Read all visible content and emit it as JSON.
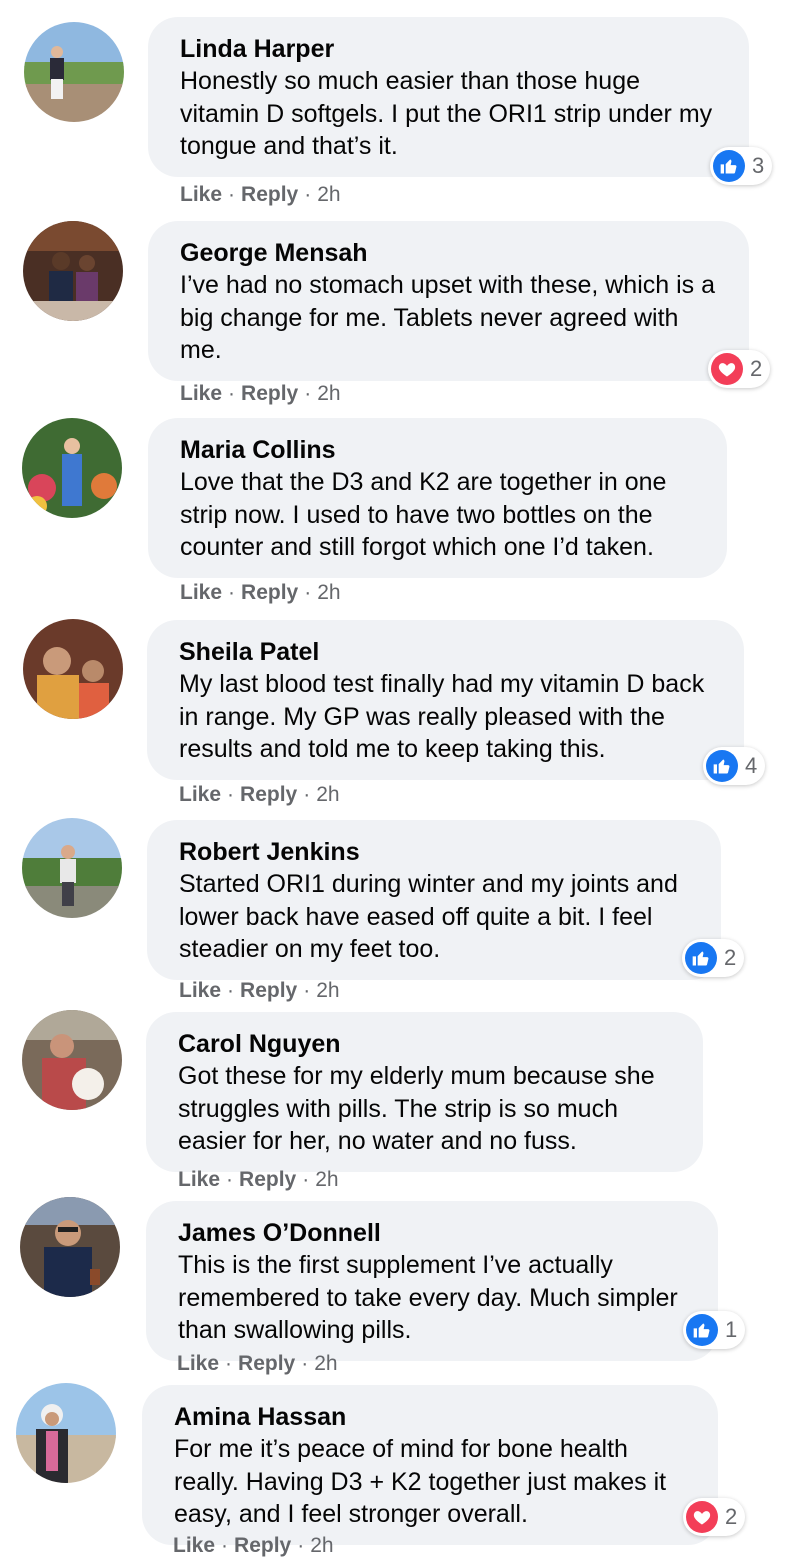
{
  "colors": {
    "like_blue": "#1877f2",
    "love_red": "#f33e58",
    "bubble_bg": "#f0f2f5",
    "meta_gray": "#65676b"
  },
  "actions": {
    "like": "Like",
    "reply": "Reply",
    "separator": "·"
  },
  "comments": [
    {
      "author": "Linda Harper",
      "text": "Honestly so much easier than those huge vitamin D softgels. I put the ORI1 strip under my tongue and that’s it.",
      "time": "2h",
      "reaction": {
        "type": "like",
        "icon": "thumbs-up-icon",
        "count": "3"
      }
    },
    {
      "author": "George Mensah",
      "text": "I’ve had no stomach upset with these, which is a big change for me. Tablets never agreed with me.",
      "time": "2h",
      "reaction": {
        "type": "love",
        "icon": "heart-icon",
        "count": "2"
      }
    },
    {
      "author": "Maria Collins",
      "text": "Love that the D3 and K2 are together in one strip now. I used to have two bottles on the counter and still forgot which one I’d taken.",
      "time": "2h",
      "reaction": null
    },
    {
      "author": "Sheila Patel",
      "text": "My last blood test finally had my vitamin D back in range. My GP was really pleased with the results and told me to keep taking this.",
      "time": "2h",
      "reaction": {
        "type": "like",
        "icon": "thumbs-up-icon",
        "count": "4"
      }
    },
    {
      "author": "Robert Jenkins",
      "text": "Started ORI1 during winter and my joints and lower back have eased off quite a bit. I feel steadier on my feet too.",
      "time": "2h",
      "reaction": {
        "type": "like",
        "icon": "thumbs-up-icon",
        "count": "2"
      }
    },
    {
      "author": "Carol Nguyen",
      "text": "Got these for my elderly mum because she struggles with pills. The strip is so much easier for her, no water and no fuss.",
      "time": "2h",
      "reaction": null
    },
    {
      "author": "James O’Donnell",
      "text": "This is the first supplement I’ve actually remembered to take every day. Much simpler than swallowing pills.",
      "time": "2h",
      "reaction": {
        "type": "like",
        "icon": "thumbs-up-icon",
        "count": "1"
      }
    },
    {
      "author": "Amina Hassan",
      "text": "For me it’s peace of mind for bone health really. Having D3 + K2 together just makes it easy, and I feel stronger overall.",
      "time": "2h",
      "reaction": {
        "type": "love",
        "icon": "heart-icon",
        "count": "2"
      }
    }
  ]
}
